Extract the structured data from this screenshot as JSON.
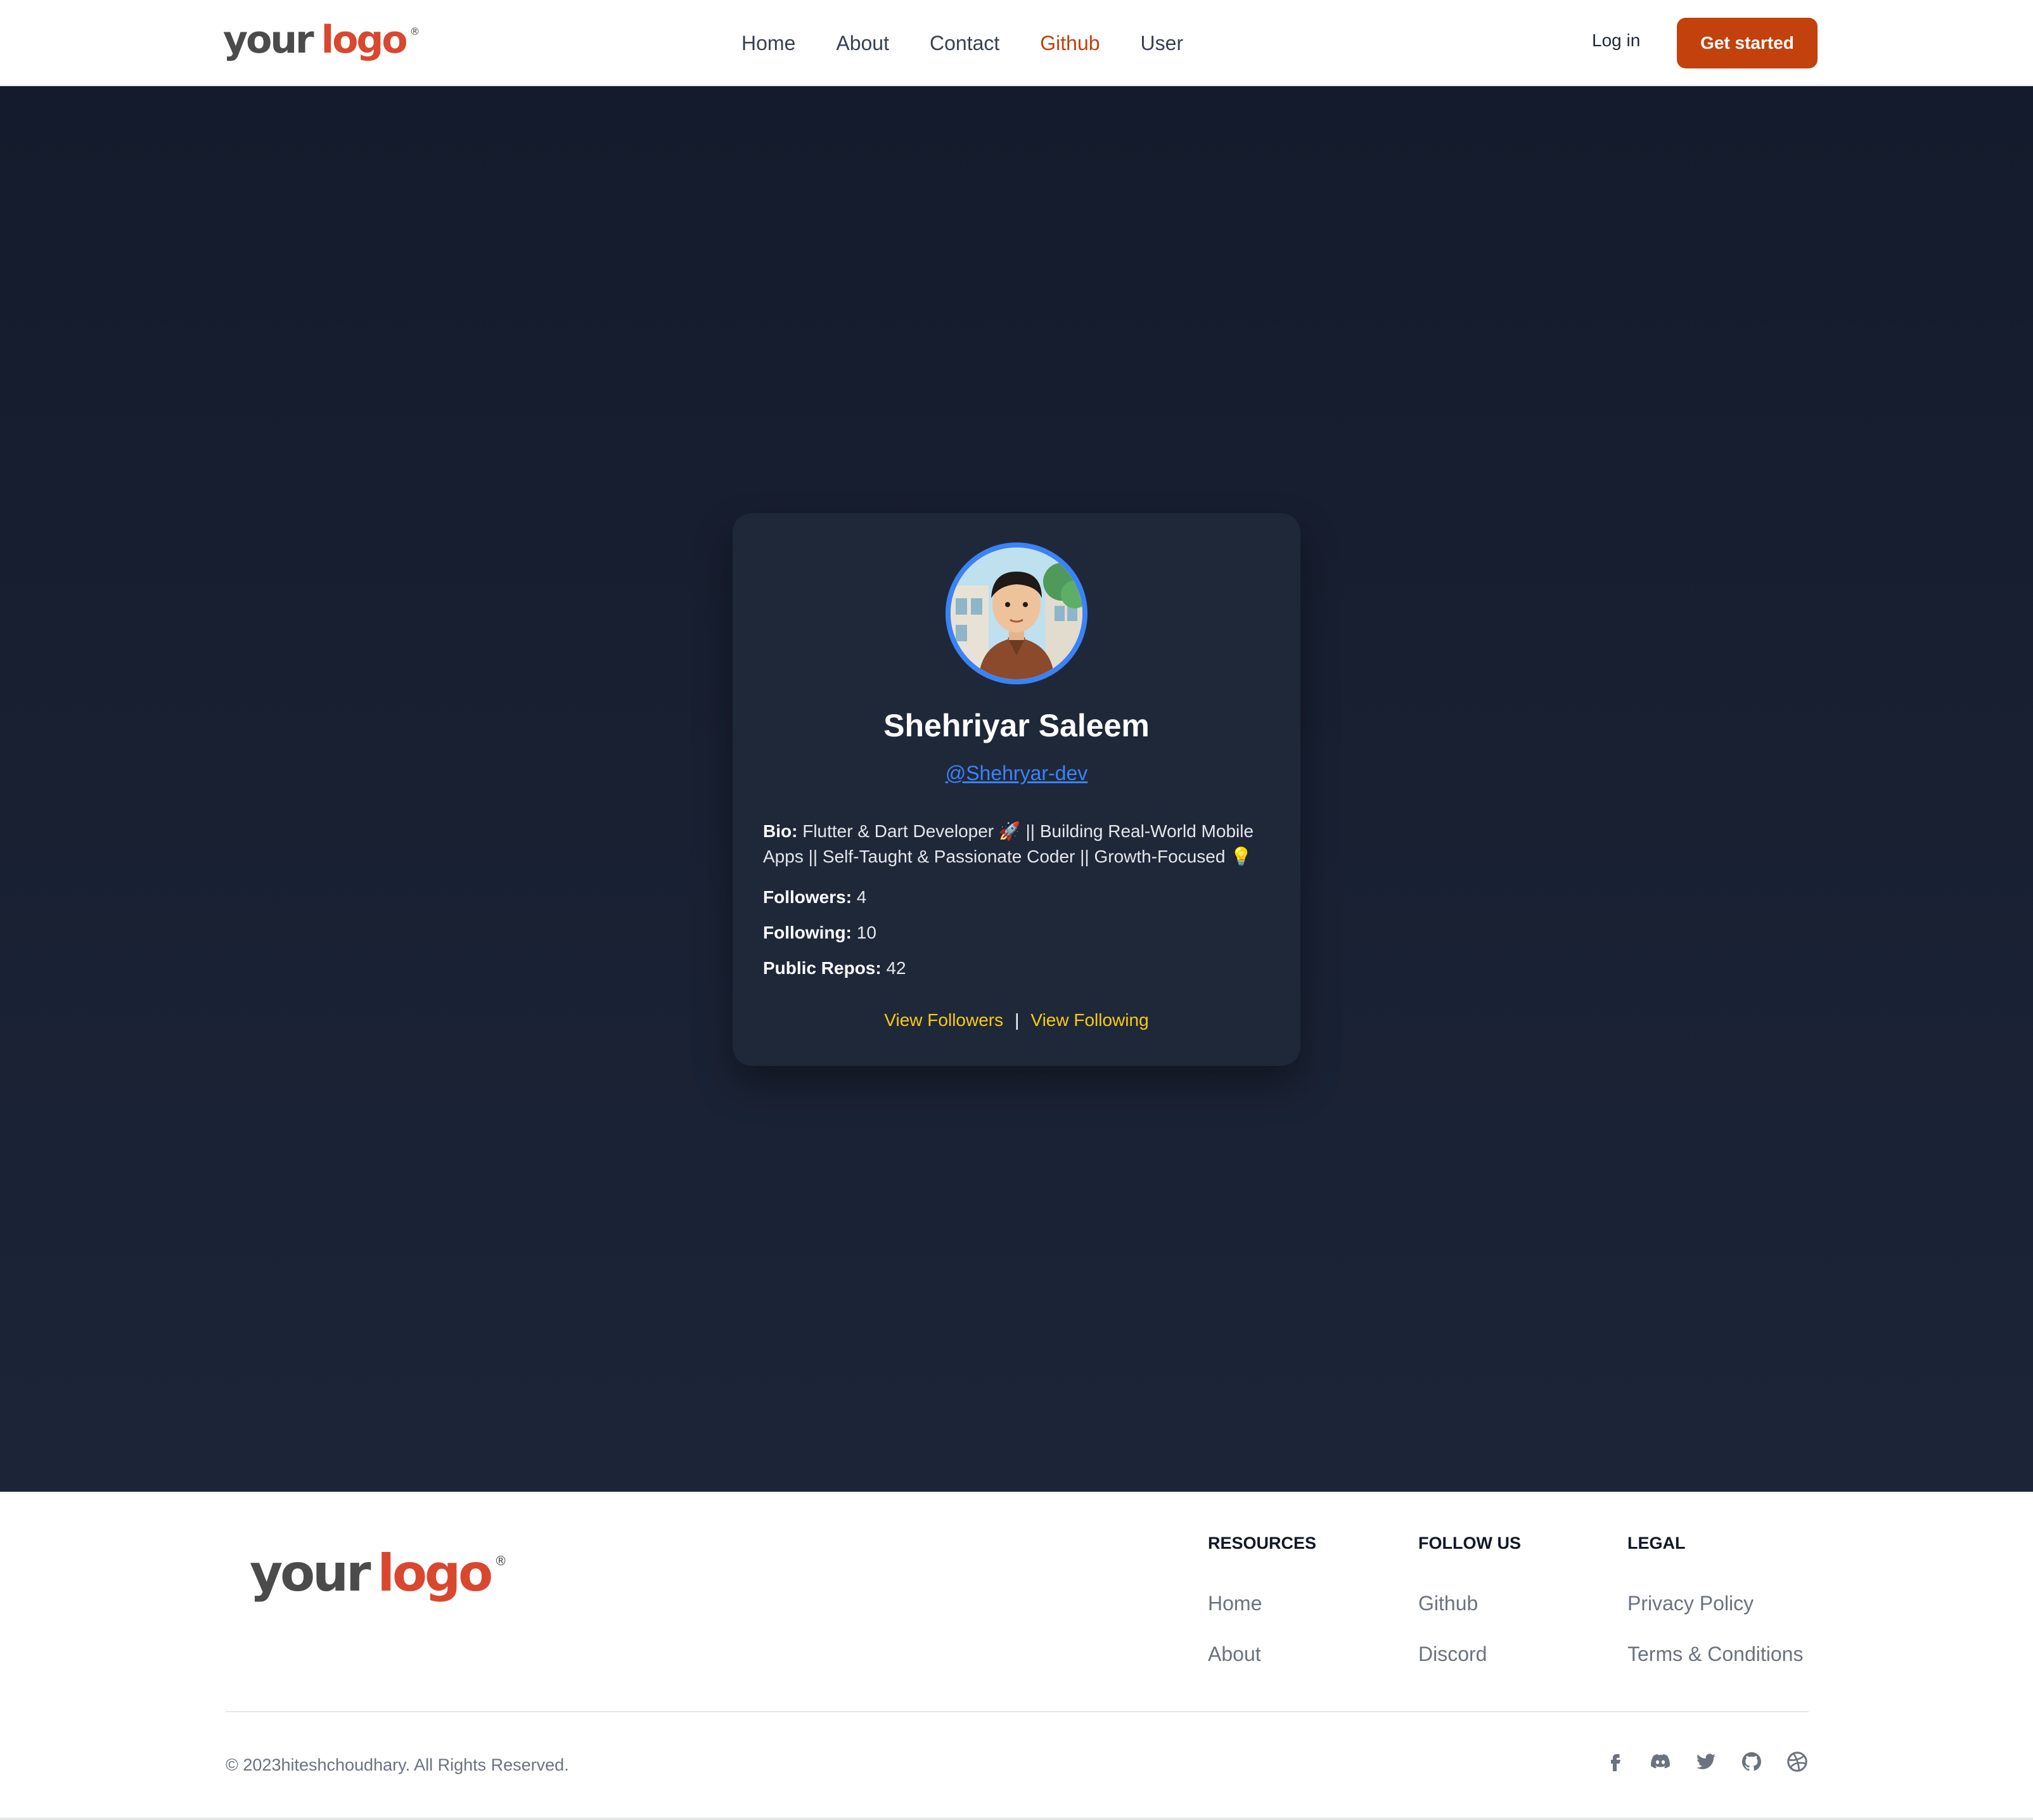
{
  "header": {
    "logo": {
      "word1": "your",
      "word2": "logo",
      "mark": "®"
    },
    "nav": [
      {
        "label": "Home",
        "active": false
      },
      {
        "label": "About",
        "active": false
      },
      {
        "label": "Contact",
        "active": false
      },
      {
        "label": "Github",
        "active": true
      },
      {
        "label": "User",
        "active": false
      }
    ],
    "login_label": "Log in",
    "cta_label": "Get started"
  },
  "profile": {
    "name": "Shehriyar Saleem",
    "handle": "@Shehryar-dev",
    "bio_label": "Bio:",
    "bio_text": " Flutter & Dart Developer 🚀 || Building Real-World Mobile Apps || Self-Taught & Passionate Coder || Growth-Focused 💡",
    "followers_label": "Followers:",
    "followers": "4",
    "following_label": "Following:",
    "following": "10",
    "repos_label": "Public Repos:",
    "repos": "42",
    "view_followers": "View Followers",
    "separator": "|",
    "view_following": "View Following"
  },
  "footer": {
    "logo": {
      "word1": "your",
      "word2": "logo",
      "mark": "®"
    },
    "columns": [
      {
        "title": "RESOURCES",
        "links": [
          "Home",
          "About"
        ]
      },
      {
        "title": "FOLLOW US",
        "links": [
          "Github",
          "Discord"
        ]
      },
      {
        "title": "LEGAL",
        "links": [
          "Privacy Policy",
          "Terms & Conditions"
        ]
      }
    ],
    "copyright": "© 2023hiteshchoudhary. All Rights Reserved.",
    "socials": [
      "facebook-icon",
      "discord-icon",
      "twitter-icon",
      "github-icon",
      "dribbble-icon"
    ]
  },
  "colors": {
    "accent": "#c2410c",
    "link_blue": "#3b82f6",
    "link_yellow": "#facc15",
    "main_bg": "#141b2c",
    "card_bg": "#1f2839"
  }
}
